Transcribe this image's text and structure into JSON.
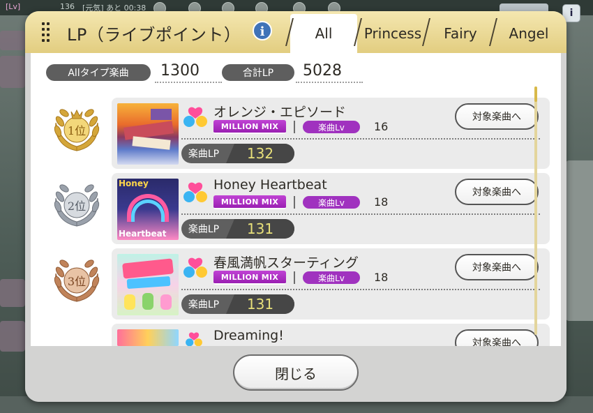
{
  "background": {
    "topbar_lv": "[Lv]",
    "topbar_num": "136",
    "topbar_genki": "[元気] あと 00:38",
    "info_label": "i"
  },
  "dialog": {
    "title": "LP（ライブポイント）",
    "info_icon": "i",
    "tabs": [
      {
        "label": "All",
        "active": true
      },
      {
        "label": "Princess",
        "active": false
      },
      {
        "label": "Fairy",
        "active": false
      },
      {
        "label": "Angel",
        "active": false
      }
    ],
    "summary": {
      "all_type_label": "Allタイプ楽曲",
      "all_type_value": "1300",
      "total_lp_label": "合計LP",
      "total_lp_value": "5028"
    },
    "songs": [
      {
        "rank_label": "1位",
        "title": "オレンジ・エピソード",
        "badge": "MILLION MIX",
        "lv_label": "楽曲Lv",
        "lv": "16",
        "lp_label": "楽曲LP",
        "lp": "132",
        "button": "対象楽曲へ"
      },
      {
        "rank_label": "2位",
        "title": "Honey Heartbeat",
        "badge": "MILLION MIX",
        "lv_label": "楽曲Lv",
        "lv": "18",
        "lp_label": "楽曲LP",
        "lp": "131",
        "button": "対象楽曲へ",
        "jacket_text_top": "Honey",
        "jacket_text_bottom": "Heartbeat"
      },
      {
        "rank_label": "3位",
        "title": "春風満帆スターティング",
        "badge": "MILLION MIX",
        "lv_label": "楽曲Lv",
        "lv": "18",
        "lp_label": "楽曲LP",
        "lp": "131",
        "button": "対象楽曲へ"
      },
      {
        "title": "Dreaming!",
        "button": "対象楽曲へ"
      }
    ],
    "close_label": "閉じる"
  },
  "colors": {
    "header_gold": "#e2cd80",
    "badge_purple": "#a032bf",
    "lp_value_yellow": "#e8e07a",
    "gold_medal": "#d4a63a",
    "silver_medal": "#9aa1ab",
    "bronze_medal": "#c0835a"
  }
}
